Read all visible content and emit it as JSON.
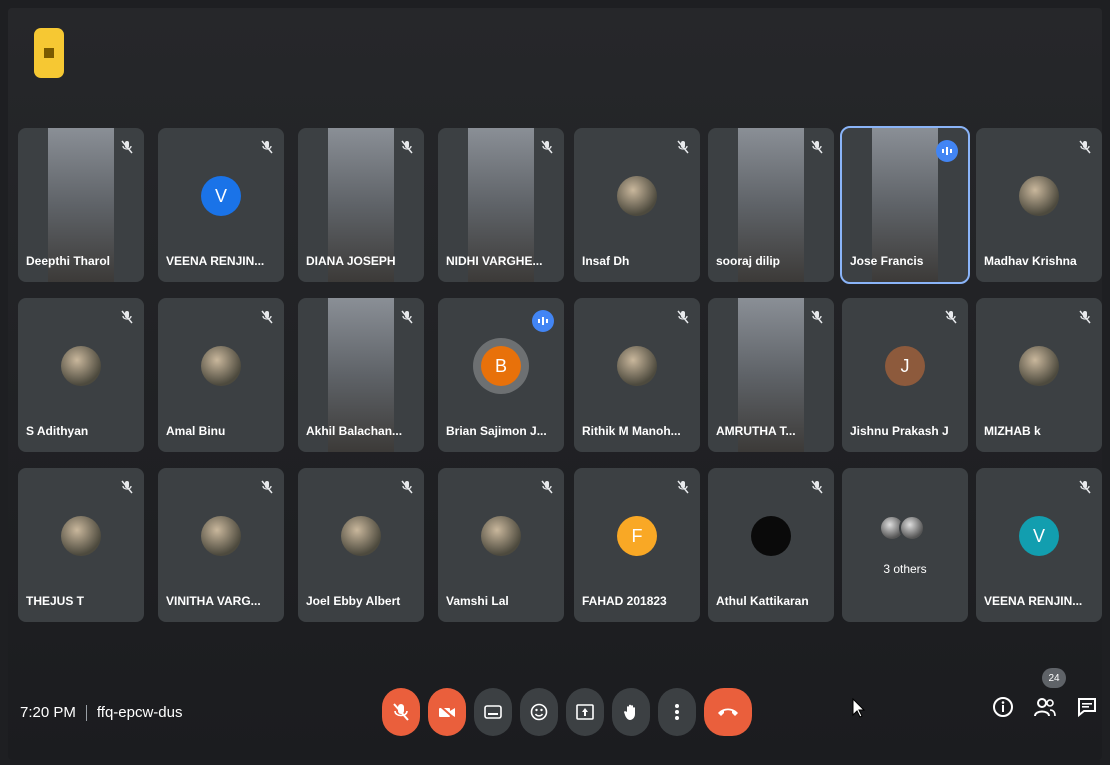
{
  "meeting": {
    "time": "7:20 PM",
    "code": "ffq-epcw-dus",
    "participant_count": "24"
  },
  "participants": [
    {
      "name": "Deepthi Tharol",
      "type": "video"
    },
    {
      "name": "VEENA RENJIN...",
      "type": "initial",
      "initial": "V",
      "color": "#1a73e8"
    },
    {
      "name": "DIANA JOSEPH",
      "type": "video"
    },
    {
      "name": "NIDHI VARGHE...",
      "type": "video"
    },
    {
      "name": "Insaf Dh",
      "type": "photo"
    },
    {
      "name": "sooraj dilip",
      "type": "video"
    },
    {
      "name": "Jose Francis",
      "type": "video",
      "speaking": true
    },
    {
      "name": "Madhav Krishna",
      "type": "photo"
    },
    {
      "name": "S Adithyan",
      "type": "photo"
    },
    {
      "name": "Amal Binu",
      "type": "photo"
    },
    {
      "name": "Akhil Balachan...",
      "type": "video"
    },
    {
      "name": "Brian Sajimon J...",
      "type": "initial",
      "initial": "B",
      "color": "#e8710a",
      "speaking": true
    },
    {
      "name": "Rithik M Manoh...",
      "type": "photo"
    },
    {
      "name": "AMRUTHA T...",
      "type": "video"
    },
    {
      "name": "Jishnu Prakash J",
      "type": "initial",
      "initial": "J",
      "color": "#8d5a3c"
    },
    {
      "name": "MIZHAB k",
      "type": "photo"
    },
    {
      "name": "THEJUS T",
      "type": "photo"
    },
    {
      "name": "VINITHA VARG...",
      "type": "photo"
    },
    {
      "name": "Joel Ebby Albert",
      "type": "photo"
    },
    {
      "name": "Vamshi Lal",
      "type": "photo"
    },
    {
      "name": "FAHAD 201823",
      "type": "initial",
      "initial": "F",
      "color": "#f9a825"
    },
    {
      "name": "Athul Kattikaran",
      "type": "dark"
    },
    {
      "name": "3 others",
      "type": "others"
    },
    {
      "name": "VEENA RENJIN...",
      "type": "initial",
      "initial": "V",
      "color": "#129eaf"
    }
  ],
  "controls": [
    {
      "name": "mic-off-button",
      "icon": "mic-off-icon",
      "style": "red"
    },
    {
      "name": "camera-off-button",
      "icon": "camera-off-icon",
      "style": "red"
    },
    {
      "name": "captions-button",
      "icon": "captions-icon",
      "style": "grey"
    },
    {
      "name": "reactions-button",
      "icon": "emoji-icon",
      "style": "grey"
    },
    {
      "name": "present-button",
      "icon": "present-icon",
      "style": "grey"
    },
    {
      "name": "raise-hand-button",
      "icon": "hand-icon",
      "style": "grey"
    },
    {
      "name": "more-options-button",
      "icon": "more-vert-icon",
      "style": "grey"
    },
    {
      "name": "leave-call-button",
      "icon": "call-end-icon",
      "style": "end"
    }
  ],
  "right_icons": [
    "info-icon",
    "people-icon",
    "chat-icon"
  ],
  "colors": {
    "speaking": "#4285f4",
    "end_call": "#ea5f3c",
    "tile": "#3c4043"
  }
}
